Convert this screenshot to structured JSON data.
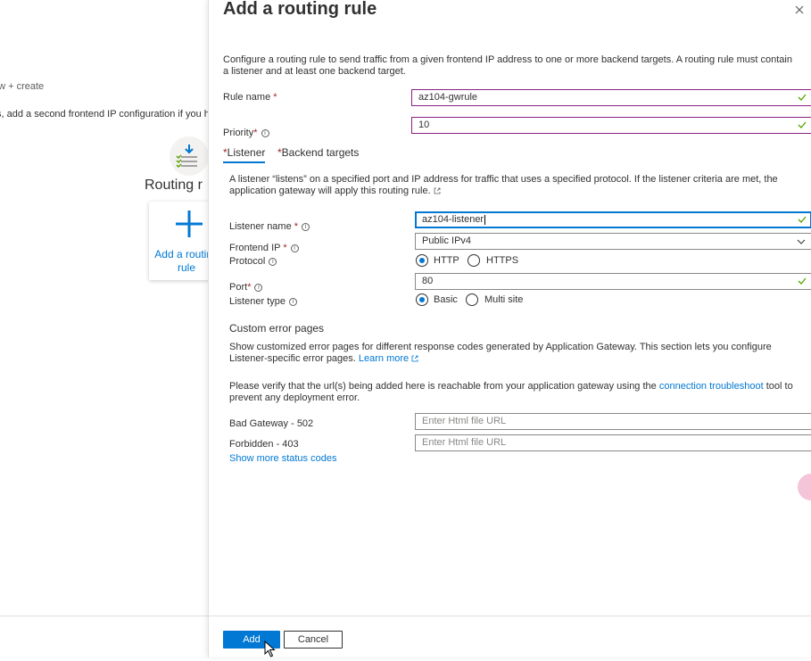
{
  "background": {
    "breadcrumb": "ew + create",
    "hint": "s, add a second frontend IP configuration if you h",
    "routing_title": "Routing r",
    "add_card_label": "Add a routing rule"
  },
  "panel": {
    "title": "Add a routing rule",
    "description": "Configure a routing rule to send traffic from a given frontend IP address to one or more backend targets. A routing rule must contain a listener and at least one backend target.",
    "rule_name_label": "Rule name",
    "rule_name_value": "az104-gwrule",
    "priority_label": "Priority",
    "priority_value": "10",
    "tabs": [
      {
        "label": "Listener",
        "active": true
      },
      {
        "label": "Backend targets",
        "active": false
      }
    ],
    "listener_description": "A listener “listens” on a specified port and IP address for traffic that uses a specified protocol. If the listener criteria are met, the application gateway will apply this routing rule.",
    "listener_name_label": "Listener name",
    "listener_name_value": "az104-listener",
    "frontend_ip_label": "Frontend IP",
    "frontend_ip_value": "Public IPv4",
    "protocol_label": "Protocol",
    "protocol_options": [
      "HTTP",
      "HTTPS"
    ],
    "protocol_selected": "HTTP",
    "port_label": "Port",
    "port_value": "80",
    "listener_type_label": "Listener type",
    "listener_type_options": [
      "Basic",
      "Multi site"
    ],
    "listener_type_selected": "Basic",
    "custom_error_heading": "Custom error pages",
    "custom_error_desc": "Show customized error pages for different response codes generated by Application Gateway. This section lets you configure Listener-specific error pages.",
    "learn_more": "Learn more",
    "verify_prefix": "Please verify that the url(s) being added here is reachable from your application gateway using the",
    "verify_link": "connection troubleshoot",
    "verify_suffix": "tool to prevent any deployment error.",
    "bad_gateway_label": "Bad Gateway - 502",
    "forbidden_label": "Forbidden - 403",
    "url_placeholder": "Enter Html file URL",
    "show_more": "Show more status codes",
    "add_button": "Add",
    "cancel_button": "Cancel"
  },
  "colors": {
    "accent": "#0078d4",
    "required": "#a4262c",
    "valid_check": "#57a300",
    "valid_border": "#8a2080"
  }
}
